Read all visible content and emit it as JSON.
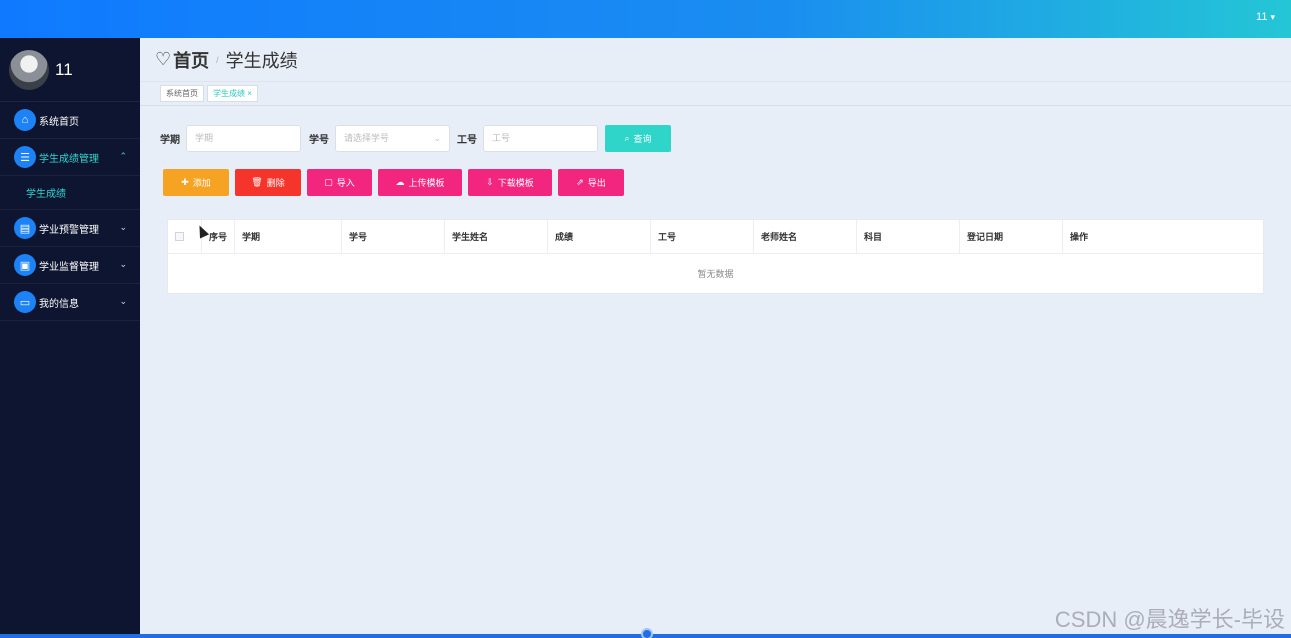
{
  "header": {
    "username": "11",
    "user_caret": "▾"
  },
  "sidebar": {
    "profile_name": "11",
    "items": [
      {
        "label": "系统首页",
        "icon": "home-icon",
        "glyph": "⌂"
      },
      {
        "label": "学生成绩管理",
        "icon": "list-icon",
        "glyph": "☰",
        "chevron": "⌃"
      },
      {
        "label": "学业预警管理",
        "icon": "message-icon",
        "glyph": "▤",
        "chevron": "⌄"
      },
      {
        "label": "学业监督管理",
        "icon": "briefcase-icon",
        "glyph": "▣",
        "chevron": "⌄"
      },
      {
        "label": "我的信息",
        "icon": "card-icon",
        "glyph": "▭",
        "chevron": "⌄"
      }
    ],
    "submenu": {
      "label": "学生成绩"
    }
  },
  "breadcrumb": {
    "home": "首页",
    "separator": "/",
    "current": "学生成绩"
  },
  "tabs": [
    {
      "label": "系统首页"
    },
    {
      "label": "学生成绩 ×"
    }
  ],
  "filters": {
    "term_label": "学期",
    "term_placeholder": "学期",
    "student_no_label": "学号",
    "student_no_placeholder": "请选择学号",
    "staff_no_label": "工号",
    "staff_no_placeholder": "工号",
    "search_label": "查询",
    "search_glyph": "⌕"
  },
  "actions": {
    "add": {
      "label": "添加",
      "glyph": "✚",
      "color": "#f6a323"
    },
    "delete": {
      "label": "删除",
      "glyph": "🗑",
      "color": "#f5352b"
    },
    "import": {
      "label": "导入",
      "glyph": "▢",
      "color": "#f2267f"
    },
    "upload_template": {
      "label": "上传模板",
      "glyph": "☁",
      "color": "#f2267f"
    },
    "download_template": {
      "label": "下载模板",
      "glyph": "⇩",
      "color": "#f2267f"
    },
    "export": {
      "label": "导出",
      "glyph": "⇗",
      "color": "#f2267f"
    }
  },
  "table": {
    "columns": [
      "序号",
      "学期",
      "学号",
      "学生姓名",
      "成绩",
      "工号",
      "老师姓名",
      "科目",
      "登记日期",
      "操作"
    ],
    "empty_text": "暂无数据"
  },
  "watermark": "CSDN @晨逸学长-毕设",
  "colors": {
    "accent": "#30d5d0",
    "primary": "#0f7aff",
    "sidebar": "#0e1530"
  }
}
